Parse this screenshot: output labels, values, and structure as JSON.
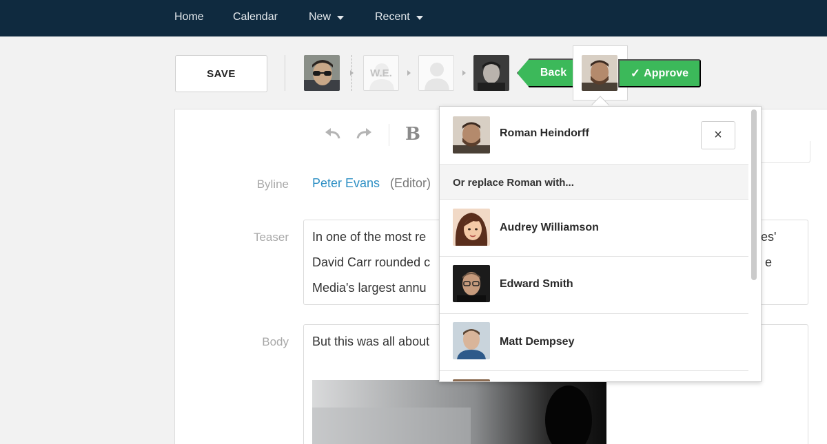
{
  "nav": {
    "items": [
      {
        "label": "Home",
        "has_caret": false
      },
      {
        "label": "Calendar",
        "has_caret": false
      },
      {
        "label": "New",
        "has_caret": true
      },
      {
        "label": "Recent",
        "has_caret": true
      }
    ],
    "bg_color": "#0f2a3f"
  },
  "toolbar": {
    "save_label": "SAVE",
    "workflow": {
      "initials_placeholder": "W.E.",
      "back_label": "Back",
      "approve_label": "Approve",
      "accent_color": "#3cb95a"
    }
  },
  "editor": {
    "toolbar_icons": [
      "undo-icon",
      "redo-icon",
      "bold-icon"
    ],
    "bold_glyph": "B",
    "fields": {
      "byline_label": "Byline",
      "byline_name": "Peter Evans",
      "byline_role": "(Editor)",
      "teaser_label": "Teaser",
      "teaser_lines": [
        "In one of the most re",
        "David Carr rounded c",
        "Media's largest annu"
      ],
      "teaser_right_fragments": [
        "es'",
        "e"
      ],
      "body_label": "Body",
      "body_line": "But this was all about"
    }
  },
  "dropdown": {
    "current": {
      "name": "Roman Heindorff"
    },
    "close_glyph": "×",
    "replace_prompt": "Or replace Roman with...",
    "options": [
      {
        "name": "Audrey Williamson"
      },
      {
        "name": "Edward Smith"
      },
      {
        "name": "Matt Dempsey"
      }
    ]
  }
}
